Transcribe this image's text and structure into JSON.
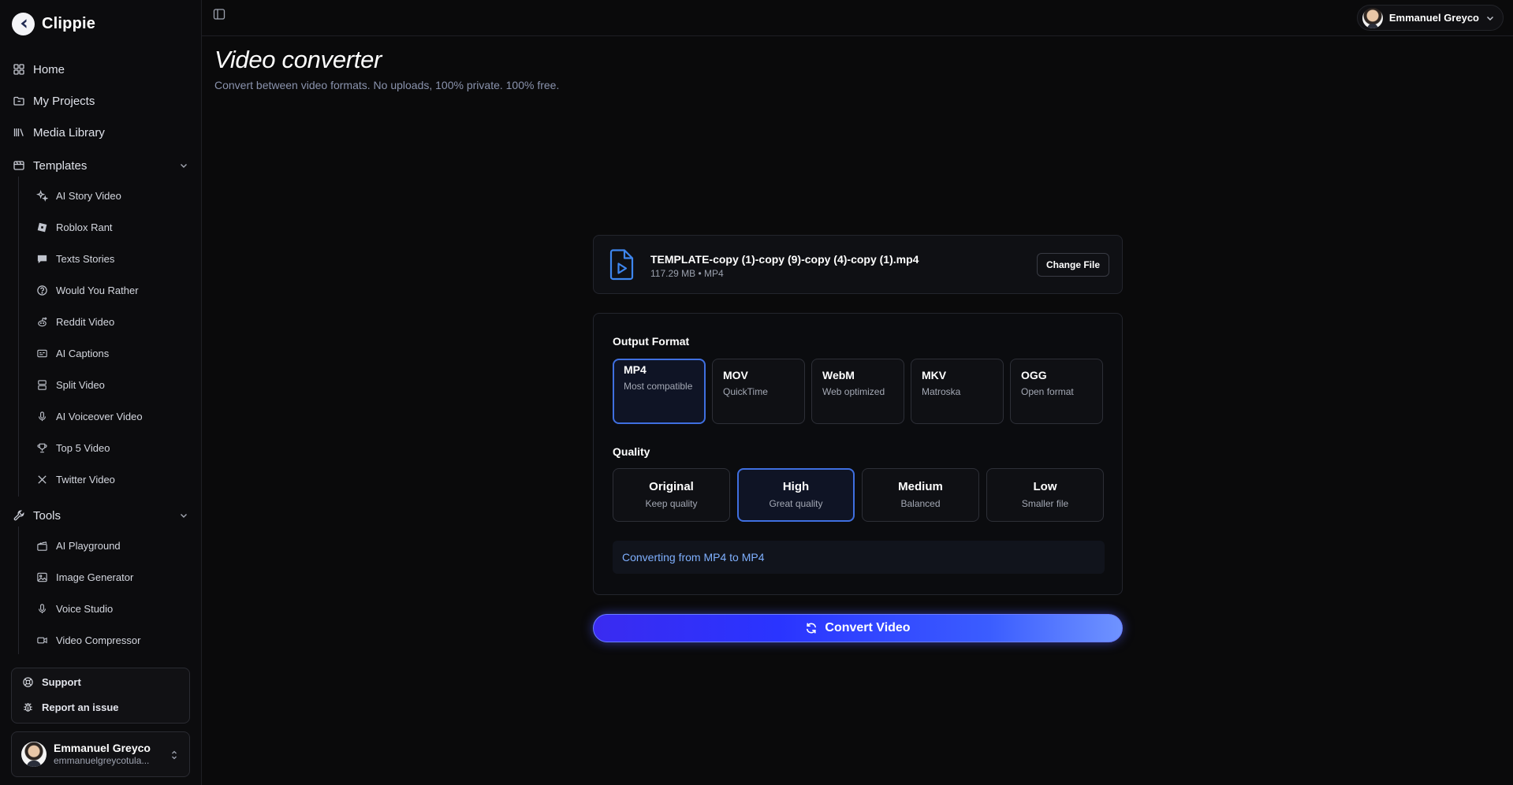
{
  "brand": {
    "name": "Clippie"
  },
  "nav": [
    {
      "label": "Home",
      "icon": "grid-icon"
    },
    {
      "label": "My Projects",
      "icon": "folder-icon"
    },
    {
      "label": "Media Library",
      "icon": "library-icon"
    }
  ],
  "templates": {
    "label": "Templates",
    "items": [
      {
        "label": "AI Story Video",
        "icon": "sparkles-icon"
      },
      {
        "label": "Roblox Rant",
        "icon": "roblox-icon"
      },
      {
        "label": "Texts Stories",
        "icon": "message-icon"
      },
      {
        "label": "Would You Rather",
        "icon": "question-icon"
      },
      {
        "label": "Reddit Video",
        "icon": "reddit-icon"
      },
      {
        "label": "AI Captions",
        "icon": "captions-icon"
      },
      {
        "label": "Split Video",
        "icon": "split-icon"
      },
      {
        "label": "AI Voiceover Video",
        "icon": "mic-icon"
      },
      {
        "label": "Top 5 Video",
        "icon": "trophy-icon"
      },
      {
        "label": "Twitter Video",
        "icon": "x-logo-icon"
      }
    ]
  },
  "tools": {
    "label": "Tools",
    "items": [
      {
        "label": "AI Playground",
        "icon": "clapper-icon"
      },
      {
        "label": "Image Generator",
        "icon": "image-icon"
      },
      {
        "label": "Voice Studio",
        "icon": "mic-icon"
      },
      {
        "label": "Video Compressor",
        "icon": "video-icon"
      }
    ]
  },
  "help": {
    "support": "Support",
    "report": "Report an issue"
  },
  "user": {
    "name": "Emmanuel Greyco",
    "email": "emmanuelgreycotula..."
  },
  "header": {
    "title": "Video converter",
    "subtitle": "Convert between video formats. No uploads, 100% private. 100% free."
  },
  "file": {
    "name": "TEMPLATE-copy (1)-copy (9)-copy (4)-copy (1).mp4",
    "meta": "117.29 MB • MP4",
    "change_label": "Change File"
  },
  "output_format": {
    "label": "Output Format",
    "selected": "MP4",
    "options": [
      {
        "name": "MP4",
        "desc": "Most compatible"
      },
      {
        "name": "MOV",
        "desc": "QuickTime"
      },
      {
        "name": "WebM",
        "desc": "Web optimized"
      },
      {
        "name": "MKV",
        "desc": "Matroska"
      },
      {
        "name": "OGG",
        "desc": "Open format"
      }
    ]
  },
  "quality": {
    "label": "Quality",
    "selected": "High",
    "options": [
      {
        "name": "Original",
        "desc": "Keep quality"
      },
      {
        "name": "High",
        "desc": "Great quality"
      },
      {
        "name": "Medium",
        "desc": "Balanced"
      },
      {
        "name": "Low",
        "desc": "Smaller file"
      }
    ]
  },
  "conversion_info": "Converting from MP4 to MP4",
  "convert_label": "Convert Video",
  "colors": {
    "accent": "#3f6fe0",
    "info_text": "#7fb0ff",
    "button_gradient_start": "#3a2bf0",
    "button_gradient_end": "#6f93ff"
  }
}
